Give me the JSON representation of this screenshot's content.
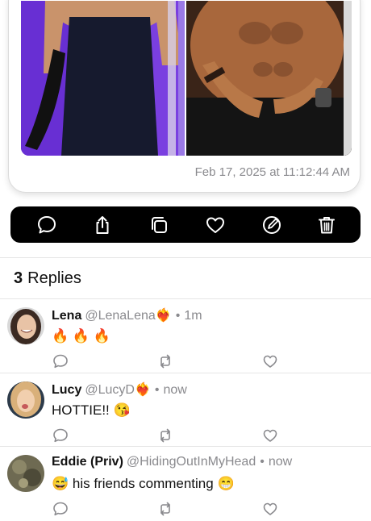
{
  "post": {
    "timestamp": "Feb 17, 2025 at 11:12:44 AM"
  },
  "action_bar": {
    "icons": [
      "reply-icon",
      "share-icon",
      "repost-icon",
      "like-icon",
      "edit-icon",
      "trash-icon"
    ]
  },
  "replies": {
    "count": "3",
    "label": "Replies",
    "items": [
      {
        "author": "Lena",
        "handle": "@LenaLena",
        "badge": "❤️‍🔥",
        "time": "1m",
        "text": "🔥 🔥 🔥"
      },
      {
        "author": "Lucy",
        "handle": "@LucyD",
        "badge": "❤️‍🔥",
        "time": "now",
        "text": "HOTTIE!! 😘"
      },
      {
        "author": "Eddie (Priv)",
        "handle": "@HidingOutInMyHead",
        "badge": "",
        "time": "now",
        "text_prefix": "😅",
        "text": "his friends commenting",
        "text_suffix": "😁"
      }
    ]
  },
  "colors": {
    "action_bar_bg": "#000000",
    "muted_text": "#8a8a8e",
    "divider": "#e6e6e6"
  }
}
